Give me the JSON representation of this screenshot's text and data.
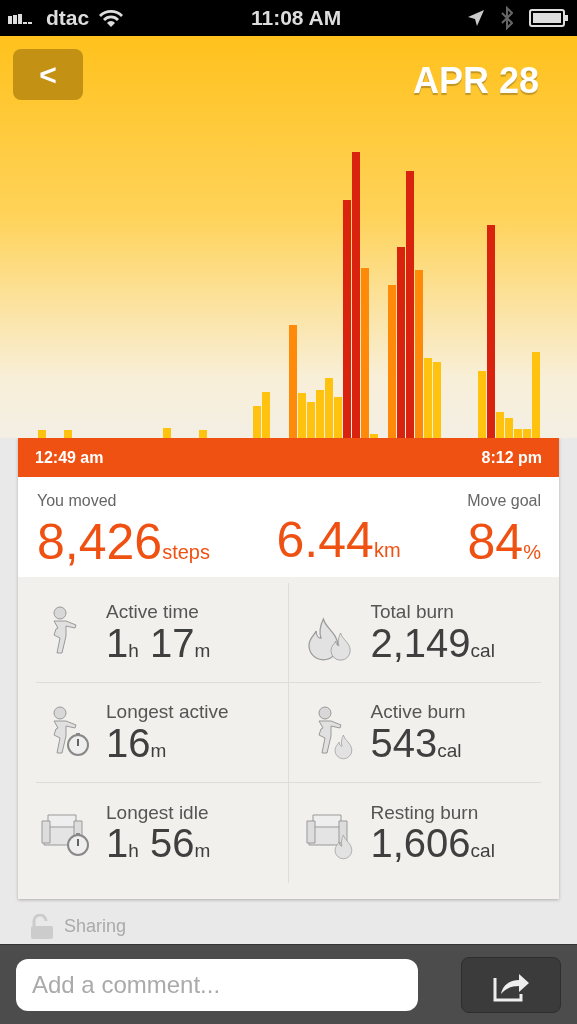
{
  "status_bar": {
    "carrier": "dtac",
    "time": "11:08 AM"
  },
  "header": {
    "back": "<",
    "date": "APR 28"
  },
  "timeline": {
    "start": "12:49 am",
    "end": "8:12 pm"
  },
  "summary": [
    {
      "label": "You moved",
      "value": "8,426",
      "unit": "steps"
    },
    {
      "value": "6.44",
      "unit": "km"
    },
    {
      "label": "Move goal",
      "value": "84",
      "unit": "%"
    }
  ],
  "stats": [
    {
      "kind": "person",
      "label": "Active time",
      "parts": [
        {
          "num": "1",
          "unit": "h"
        },
        {
          "num": "17",
          "unit": "m"
        }
      ]
    },
    {
      "kind": "flames",
      "label": "Total burn",
      "parts": [
        {
          "num": "2,149",
          "unit": "cal"
        }
      ]
    },
    {
      "kind": "person_stopwatch",
      "label": "Longest active",
      "parts": [
        {
          "num": "16",
          "unit": "m"
        }
      ]
    },
    {
      "kind": "person_flame",
      "label": "Active burn",
      "parts": [
        {
          "num": "543",
          "unit": "cal"
        }
      ]
    },
    {
      "kind": "sofa_stopwatch",
      "label": "Longest idle",
      "parts": [
        {
          "num": "1",
          "unit": "h"
        },
        {
          "num": "56",
          "unit": "m"
        }
      ]
    },
    {
      "kind": "sofa_flame",
      "label": "Resting burn",
      "parts": [
        {
          "num": "1,606",
          "unit": "cal"
        }
      ]
    }
  ],
  "sharing": {
    "label": "Sharing"
  },
  "comment": {
    "placeholder": "Add a comment..."
  }
}
